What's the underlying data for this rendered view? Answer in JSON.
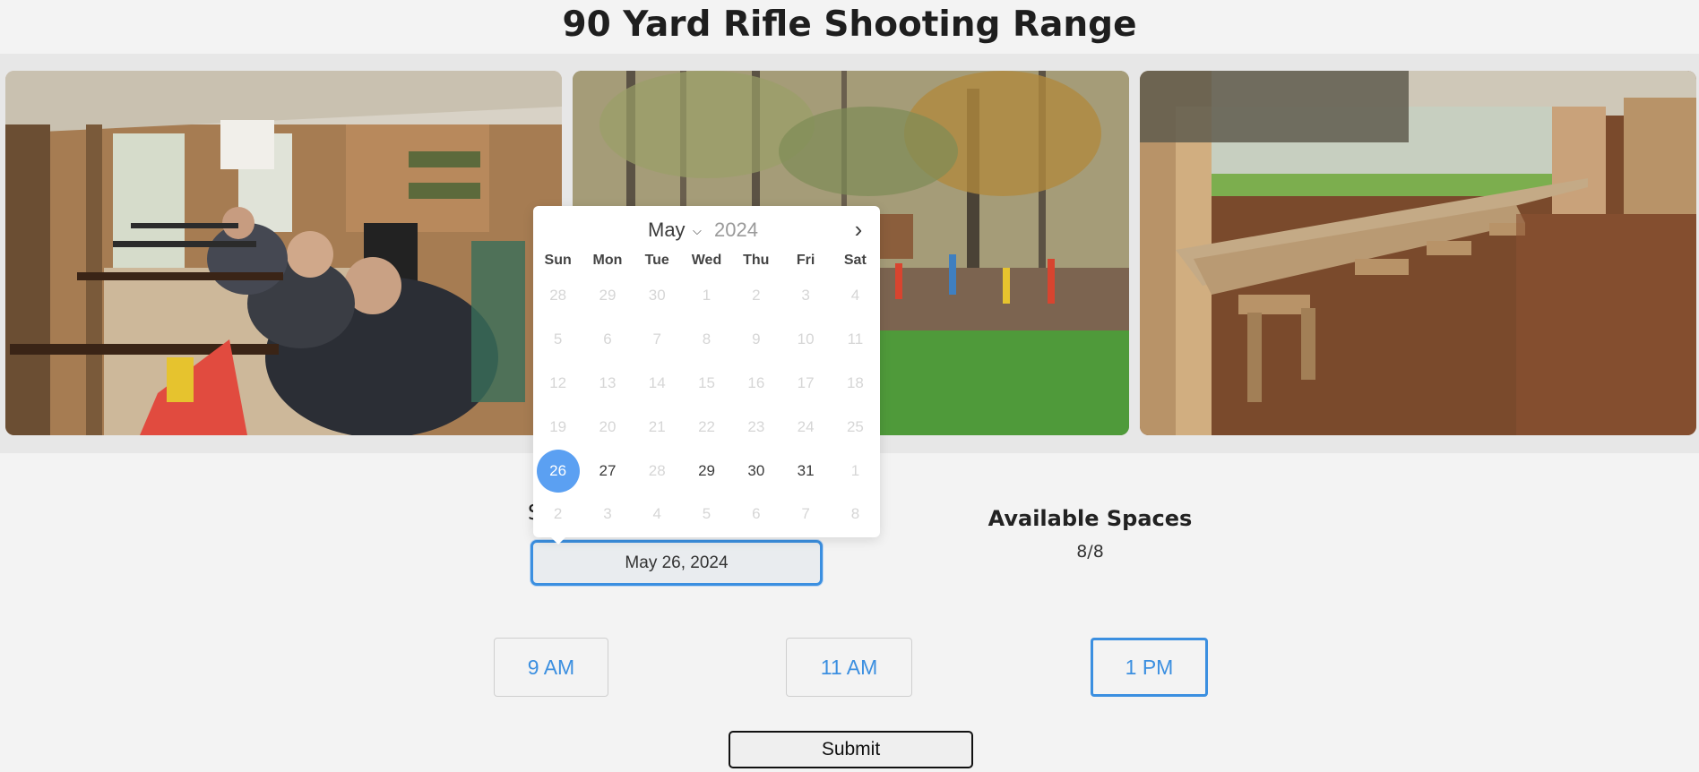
{
  "page": {
    "title": "90 Yard Rifle Shooting Range"
  },
  "form": {
    "date_label": "S",
    "date_value": "May 26, 2024",
    "spaces_title": "Available Spaces",
    "spaces_value": "8/8",
    "times": [
      {
        "label": "9 AM",
        "selected": false
      },
      {
        "label": "11 AM",
        "selected": false
      },
      {
        "label": "1 PM",
        "selected": true
      }
    ],
    "submit_label": "Submit"
  },
  "calendar": {
    "month": "May",
    "year": "2024",
    "weekdays": [
      "Sun",
      "Mon",
      "Tue",
      "Wed",
      "Thu",
      "Fri",
      "Sat"
    ],
    "days": [
      {
        "d": "28",
        "state": "disabled"
      },
      {
        "d": "29",
        "state": "disabled"
      },
      {
        "d": "30",
        "state": "disabled"
      },
      {
        "d": "1",
        "state": "disabled"
      },
      {
        "d": "2",
        "state": "disabled"
      },
      {
        "d": "3",
        "state": "disabled"
      },
      {
        "d": "4",
        "state": "disabled"
      },
      {
        "d": "5",
        "state": "disabled"
      },
      {
        "d": "6",
        "state": "disabled"
      },
      {
        "d": "7",
        "state": "disabled"
      },
      {
        "d": "8",
        "state": "disabled"
      },
      {
        "d": "9",
        "state": "disabled"
      },
      {
        "d": "10",
        "state": "disabled"
      },
      {
        "d": "11",
        "state": "disabled"
      },
      {
        "d": "12",
        "state": "disabled"
      },
      {
        "d": "13",
        "state": "disabled"
      },
      {
        "d": "14",
        "state": "disabled"
      },
      {
        "d": "15",
        "state": "disabled"
      },
      {
        "d": "16",
        "state": "disabled"
      },
      {
        "d": "17",
        "state": "disabled"
      },
      {
        "d": "18",
        "state": "disabled"
      },
      {
        "d": "19",
        "state": "disabled"
      },
      {
        "d": "20",
        "state": "disabled"
      },
      {
        "d": "21",
        "state": "disabled"
      },
      {
        "d": "22",
        "state": "disabled"
      },
      {
        "d": "23",
        "state": "disabled"
      },
      {
        "d": "24",
        "state": "disabled"
      },
      {
        "d": "25",
        "state": "disabled"
      },
      {
        "d": "26",
        "state": "selected"
      },
      {
        "d": "27",
        "state": "available"
      },
      {
        "d": "28",
        "state": "disabled"
      },
      {
        "d": "29",
        "state": "available"
      },
      {
        "d": "30",
        "state": "available"
      },
      {
        "d": "31",
        "state": "available"
      },
      {
        "d": "1",
        "state": "disabled"
      },
      {
        "d": "2",
        "state": "disabled"
      },
      {
        "d": "3",
        "state": "disabled"
      },
      {
        "d": "4",
        "state": "disabled"
      },
      {
        "d": "5",
        "state": "disabled"
      },
      {
        "d": "6",
        "state": "disabled"
      },
      {
        "d": "7",
        "state": "disabled"
      },
      {
        "d": "8",
        "state": "disabled"
      }
    ]
  },
  "icons": {
    "next_month": "chevron-right-icon",
    "month_dropdown": "chevron-down-icon"
  },
  "colors": {
    "accent": "#3b8fe0",
    "selected_day": "#5ba0f2",
    "background": "#f3f3f3"
  }
}
